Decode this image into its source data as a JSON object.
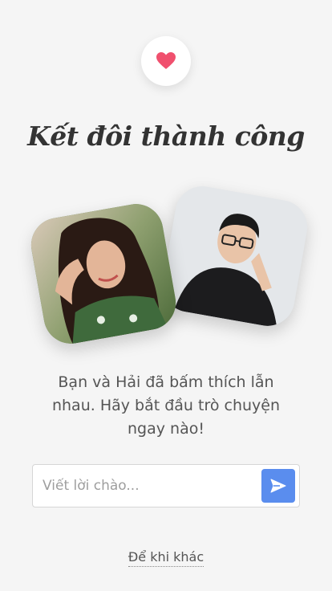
{
  "header": {
    "icon": "heart-icon",
    "accent_color": "#f0506e"
  },
  "title": "Kết đôi thành công",
  "photos": [
    {
      "icon": "female-photo"
    },
    {
      "icon": "male-photo"
    }
  ],
  "message": "Bạn và Hải đã bấm thích lẫn nhau. Hãy bắt đầu trò chuyện ngay nào!",
  "greeting": {
    "placeholder": "Viết lời chào...",
    "value": "",
    "send_icon": "send-icon",
    "send_color": "#5a8dee"
  },
  "later_link": "Để khi khác"
}
